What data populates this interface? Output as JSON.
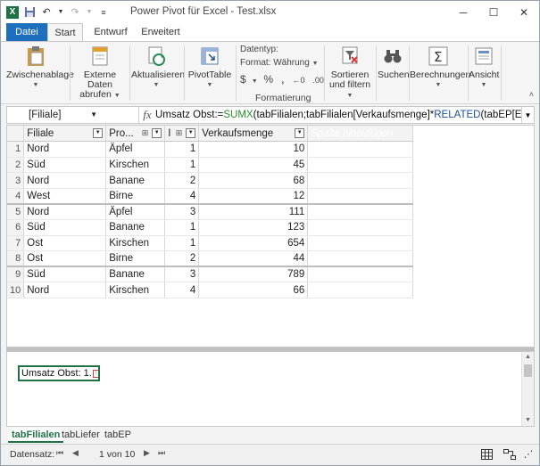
{
  "window": {
    "title": "Power Pivot für Excel - Test.xlsx"
  },
  "ribbon_tabs": [
    "Datei",
    "Start",
    "Entwurf",
    "Erweitert"
  ],
  "ribbon": {
    "clipboard": "Zwischenablage",
    "external_line1": "Externe Daten",
    "external_line2": "abrufen",
    "refresh": "Aktualisieren",
    "pivottable": "PivotTable",
    "datatype_label": "Datentyp:",
    "format_label": "Format: Währung",
    "formatting_group": "Formatierung",
    "sort_line1": "Sortieren",
    "sort_line2": "und filtern",
    "search": "Suchen",
    "calculations": "Berechnungen",
    "view": "Ansicht"
  },
  "formula_bar": {
    "name_box": "[Filiale]",
    "fx": "fx",
    "formula_prefix": "Umsatz Obst:=",
    "formula_fn1": "SUMX",
    "formula_mid": "(tabFilialen;tabFilialen[Verkaufsmenge]*",
    "formula_fn2": "RELATED",
    "formula_suffix": "(tabEP[EP]))"
  },
  "columns": {
    "filiale": "Filiale",
    "produkt": "Pro...",
    "id": "I",
    "verkaufsmenge": "Verkaufsmenge",
    "add": "Spalte hinzufügen"
  },
  "rows": [
    {
      "n": "1",
      "filiale": "Nord",
      "produkt": "Äpfel",
      "id": "1",
      "menge": "10"
    },
    {
      "n": "2",
      "filiale": "Süd",
      "produkt": "Kirschen",
      "id": "1",
      "menge": "45"
    },
    {
      "n": "3",
      "filiale": "Nord",
      "produkt": "Banane",
      "id": "2",
      "menge": "68"
    },
    {
      "n": "4",
      "filiale": "West",
      "produkt": "Birne",
      "id": "4",
      "menge": "12"
    },
    {
      "n": "5",
      "filiale": "Nord",
      "produkt": "Äpfel",
      "id": "3",
      "menge": "111"
    },
    {
      "n": "6",
      "filiale": "Süd",
      "produkt": "Banane",
      "id": "1",
      "menge": "123"
    },
    {
      "n": "7",
      "filiale": "Ost",
      "produkt": "Kirschen",
      "id": "1",
      "menge": "654"
    },
    {
      "n": "8",
      "filiale": "Ost",
      "produkt": "Birne",
      "id": "2",
      "menge": "44"
    },
    {
      "n": "9",
      "filiale": "Süd",
      "produkt": "Banane",
      "id": "3",
      "menge": "789"
    },
    {
      "n": "10",
      "filiale": "Nord",
      "produkt": "Kirschen",
      "id": "4",
      "menge": "66"
    }
  ],
  "measure": {
    "label": "Umsatz Obst: 1."
  },
  "sheet_tabs": [
    "tabFilialen",
    "tabLiefer",
    "tabEP"
  ],
  "status": {
    "label": "Datensatz:",
    "record": "1 von 10"
  },
  "colors": {
    "accent_green": "#217346",
    "add_column": "#8fc79a",
    "file_tab": "#1f6fbf"
  }
}
